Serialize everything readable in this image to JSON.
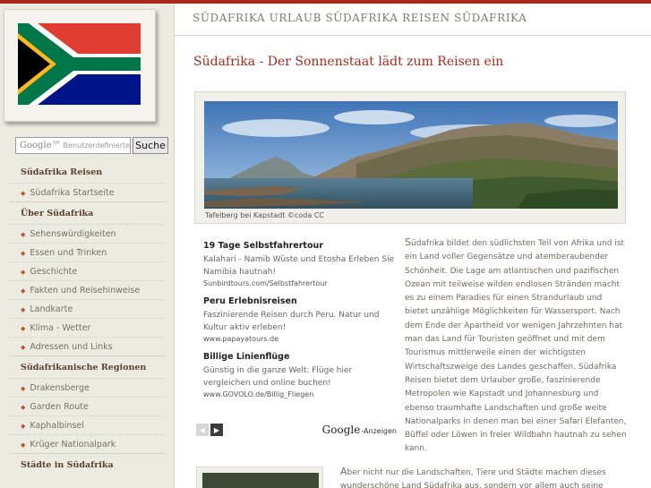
{
  "site": {
    "header_title": "SÜDAFRIKA URLAUB SÜDAFRIKA REISEN SÜDAFRIKA"
  },
  "colors": {
    "accent": "#a8281c",
    "sidebar_bg": "#ecebe1",
    "flag_red": "#e03c31",
    "flag_blue": "#001489",
    "flag_green": "#007749",
    "flag_gold": "#ffb81c"
  },
  "search": {
    "brand": "Google™",
    "placeholder": "Benutzerdefinierte",
    "button_label": "Suche"
  },
  "sidebar": {
    "sections": [
      {
        "heading": "Südafrika Reisen",
        "items": [
          "Südafrika Startseite"
        ]
      },
      {
        "heading": "Über Südafrika",
        "items": [
          "Sehenswürdigkeiten",
          "Essen und Trinken",
          "Geschichte",
          "Fakten und Reisehinweise",
          "Landkarte",
          "Klima - Wetter",
          "Adressen und Links"
        ]
      },
      {
        "heading": "Südafrikanische Regionen",
        "items": [
          "Drakensberge",
          "Garden Route",
          "Kaphalbinsel",
          "Krüger Nationalpark"
        ]
      },
      {
        "heading": "Städte in Südafrika",
        "items": []
      }
    ]
  },
  "main": {
    "title": "Südafrika - Der Sonnenstaat lädt zum Reisen ein",
    "photo_caption": "Tafelberg bei Kapstadt ©coda CC",
    "ads": [
      {
        "title": "19 Tage Selbstfahrertour",
        "desc": "Kalahari - Namib Wüste und Etosha Erleben Sie Namibia hautnah!",
        "url": "Sunbirdtours.com/Selbstfahrertour"
      },
      {
        "title": "Peru Erlebnisreisen",
        "desc": "Faszinierende Reisen durch Peru. Natur und Kultur aktiv erleben!",
        "url": "www.papayatours.de"
      },
      {
        "title": "Billige Linienflüge",
        "desc": "Günstig in die ganze Welt: Flüge hier vergleichen und online buchen!",
        "url": "www.GOVOLO.de/Billig_Fliegen"
      }
    ],
    "ads_brand": "Google",
    "ads_label": "-Anzeigen",
    "intro_drop": "S",
    "intro_text": "üdafrika bildet den südlichsten Teil von Afrika und ist ein Land voller Gegensätze und atemberaubender Schönheit. Die Lage am atlantischen und pazifischen Ozean mit teilweise wilden endlosen Stränden macht es zu einem Paradies für einen Strandurlaub und bietet unzählige Möglichkeiten für Wassersport. Nach dem Ende der Apartheid vor wenigen Jahrzehnten hat man das Land für Touristen geöffnet und mit dem Tourismus mittlerweile einen der wichtigsten Wirtschaftszweige des Landes geschaffen. Südafrika Reisen bietet dem Urlauber große, faszinierende Metropolen wie Kapstadt und Johannesburg und ebenso traumhafte Landschaften und große weite Nationalparks in denen man bei einer Safari Elefanten, Büffel oder Löwen in freier Wildbahn hautnah zu sehen kann.",
    "intro2_drop": "A",
    "intro2_text": "ber nicht nur die Landschaften, Tiere und Städte machen dieses wunderschöne Land Südafrika aus, sondern vor allem auch seine"
  }
}
